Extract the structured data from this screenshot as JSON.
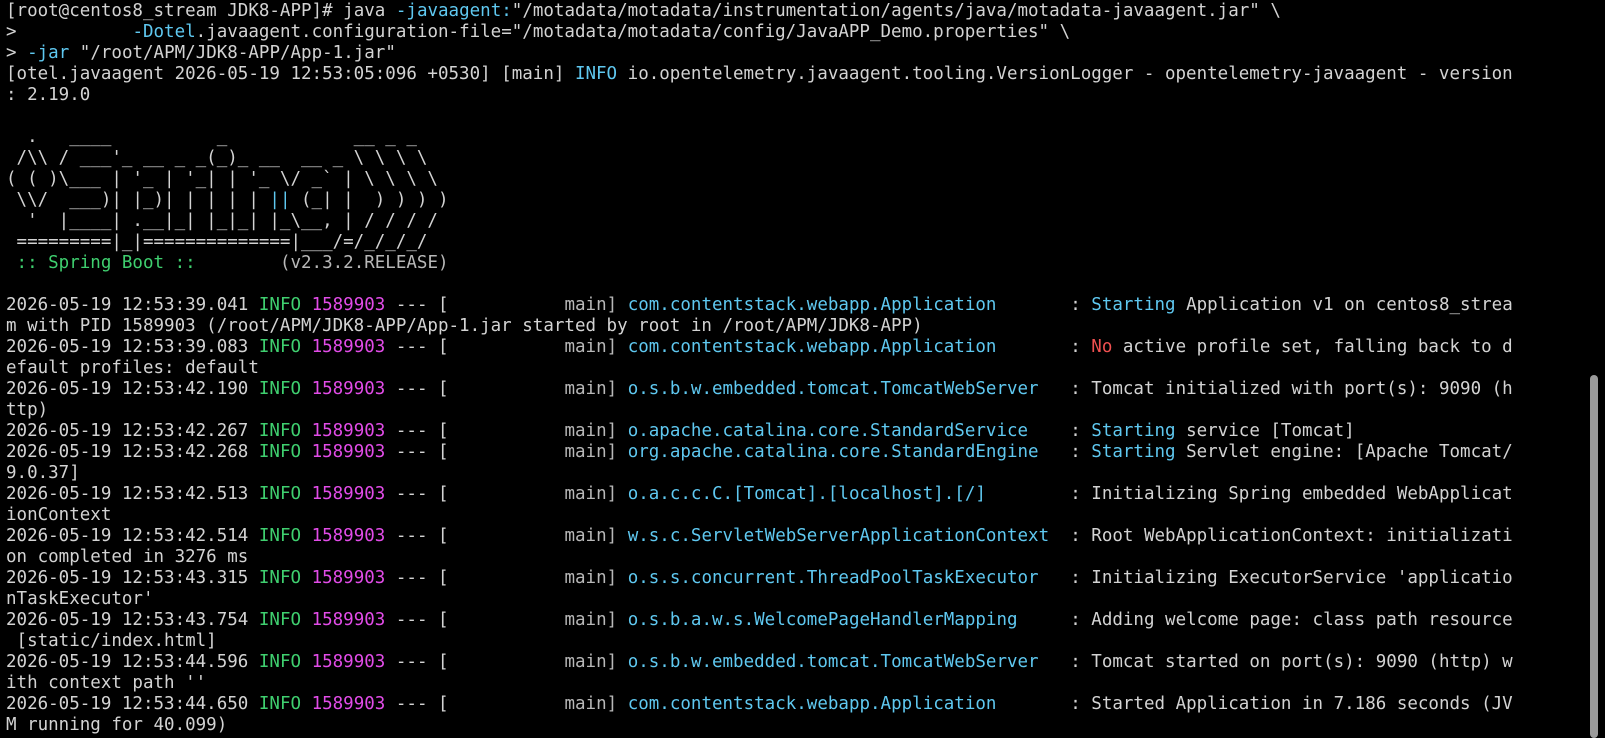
{
  "terminal": {
    "prompt": "[root@centos8_stream JDK8-APP]#",
    "cmd_java": "java",
    "cmd_opt1": "-javaagent:",
    "cmd_path1": "\"/motadata/motadata/instrumentation/agents/java/motadata-javaagent.jar\"",
    "cmd_cont": "\\",
    "cont_prompt": ">",
    "cmd_opt2": "-Dotel",
    "cmd_opt2_rest": ".javaagent.configuration-file=\"/motadata/motadata/config/JavaAPP_Demo.properties\"",
    "cmd_opt3": "-jar",
    "cmd_path3": "\"/root/APM/JDK8-APP/App-1.jar\"",
    "otel_prefix": "[otel.javaagent 2026-05-19 12:53:05:096 +0530] [main]",
    "otel_level": "INFO",
    "otel_rest": "io.opentelemetry.javaagent.tooling.VersionLogger - opentelemetry-javaagent - version",
    "otel_wrap": ": 2.19.0"
  },
  "banner": {
    "b1": "  .   ____          _            __ _ _",
    "b2a": " /\\\\ / ___'_ __ _ _(_)_ __  __ _ \\ \\ \\ \\",
    "b3a": "( ( )\\___ | '_ | '_| | '_ \\/ _` | \\ \\ \\ \\",
    "b4a": " \\\\/  ___)| |_)| | | | | ",
    "b4b": "||",
    "b4c": " (_| |  ) ) ) )",
    "b5": "  '  |____| .__|_| |_|_| |_\\__, | / / / /",
    "b6": " =========|_|==============|___/=/_/_/_/",
    "boot_label": " :: Spring Boot :: ",
    "boot_version": "       (v2.3.2.RELEASE)"
  },
  "log": {
    "entries": [
      {
        "ts": "2026-05-19 12:53:39.041",
        "level": "INFO",
        "pid": "1589903",
        "sep": " --- [",
        "thread": "           main]",
        "logger": "com.contentstack.webapp.Application      ",
        "colon": " : ",
        "hl": "Starting",
        "hl_color": "cyan",
        "msg": " Application v1 on centos8_strea",
        "wrap": "m with PID 1589903 (/root/APM/JDK8-APP/App-1.jar started by root in /root/APM/JDK8-APP)"
      },
      {
        "ts": "2026-05-19 12:53:39.083",
        "level": "INFO",
        "pid": "1589903",
        "sep": " --- [",
        "thread": "           main]",
        "logger": "com.contentstack.webapp.Application      ",
        "colon": " : ",
        "hl": "No",
        "hl_color": "red",
        "msg": " active profile set, falling back to d",
        "wrap": "efault profiles: default"
      },
      {
        "ts": "2026-05-19 12:53:42.190",
        "level": "INFO",
        "pid": "1589903",
        "sep": " --- [",
        "thread": "           main]",
        "logger": "o.s.b.w.embedded.tomcat.TomcatWebServer  ",
        "colon": " : ",
        "hl": "",
        "hl_color": "",
        "msg": "Tomcat initialized with port(s): 9090 (h",
        "wrap": "ttp)"
      },
      {
        "ts": "2026-05-19 12:53:42.267",
        "level": "INFO",
        "pid": "1589903",
        "sep": " --- [",
        "thread": "           main]",
        "logger": "o.apache.catalina.core.StandardService   ",
        "colon": " : ",
        "hl": "Starting",
        "hl_color": "cyan",
        "msg": " service [Tomcat]",
        "wrap": ""
      },
      {
        "ts": "2026-05-19 12:53:42.268",
        "level": "INFO",
        "pid": "1589903",
        "sep": " --- [",
        "thread": "           main]",
        "logger": "org.apache.catalina.core.StandardEngine  ",
        "colon": " : ",
        "hl": "Starting",
        "hl_color": "cyan",
        "msg": " Servlet engine: [Apache Tomcat/",
        "wrap": "9.0.37]"
      },
      {
        "ts": "2026-05-19 12:53:42.513",
        "level": "INFO",
        "pid": "1589903",
        "sep": " --- [",
        "thread": "           main]",
        "logger": "o.a.c.c.C.[Tomcat].[localhost].[/]       ",
        "colon": " : ",
        "hl": "",
        "hl_color": "",
        "msg": "Initializing Spring embedded WebApplicat",
        "wrap": "ionContext"
      },
      {
        "ts": "2026-05-19 12:53:42.514",
        "level": "INFO",
        "pid": "1589903",
        "sep": " --- [",
        "thread": "           main]",
        "logger": "w.s.c.ServletWebServerApplicationContext ",
        "colon": " : ",
        "hl": "",
        "hl_color": "",
        "msg": "Root WebApplicationContext: initializati",
        "wrap": "on completed in 3276 ms"
      },
      {
        "ts": "2026-05-19 12:53:43.315",
        "level": "INFO",
        "pid": "1589903",
        "sep": " --- [",
        "thread": "           main]",
        "logger": "o.s.s.concurrent.ThreadPoolTaskExecutor  ",
        "colon": " : ",
        "hl": "",
        "hl_color": "",
        "msg": "Initializing ExecutorService 'applicatio",
        "wrap": "nTaskExecutor'"
      },
      {
        "ts": "2026-05-19 12:53:43.754",
        "level": "INFO",
        "pid": "1589903",
        "sep": " --- [",
        "thread": "           main]",
        "logger": "o.s.b.a.w.s.WelcomePageHandlerMapping    ",
        "colon": " : ",
        "hl": "",
        "hl_color": "",
        "msg": "Adding welcome page: class path resource",
        "wrap": " [static/index.html]"
      },
      {
        "ts": "2026-05-19 12:53:44.596",
        "level": "INFO",
        "pid": "1589903",
        "sep": " --- [",
        "thread": "           main]",
        "logger": "o.s.b.w.embedded.tomcat.TomcatWebServer  ",
        "colon": " : ",
        "hl": "",
        "hl_color": "",
        "msg": "Tomcat started on port(s): 9090 (http) w",
        "wrap": "ith context path ''"
      },
      {
        "ts": "2026-05-19 12:53:44.650",
        "level": "INFO",
        "pid": "1589903",
        "sep": " --- [",
        "thread": "           main]",
        "logger": "com.contentstack.webapp.Application      ",
        "colon": " : ",
        "hl": "",
        "hl_color": "",
        "msg": "Started Application in 7.186 seconds (JV",
        "wrap": "M running for 40.099)"
      }
    ]
  },
  "colors": {
    "background": "#000000",
    "foreground": "#d3d3d3",
    "cyan": "#5fc8f0",
    "green": "#3fcf6f",
    "magenta": "#e24ce8",
    "red": "#f05050"
  }
}
